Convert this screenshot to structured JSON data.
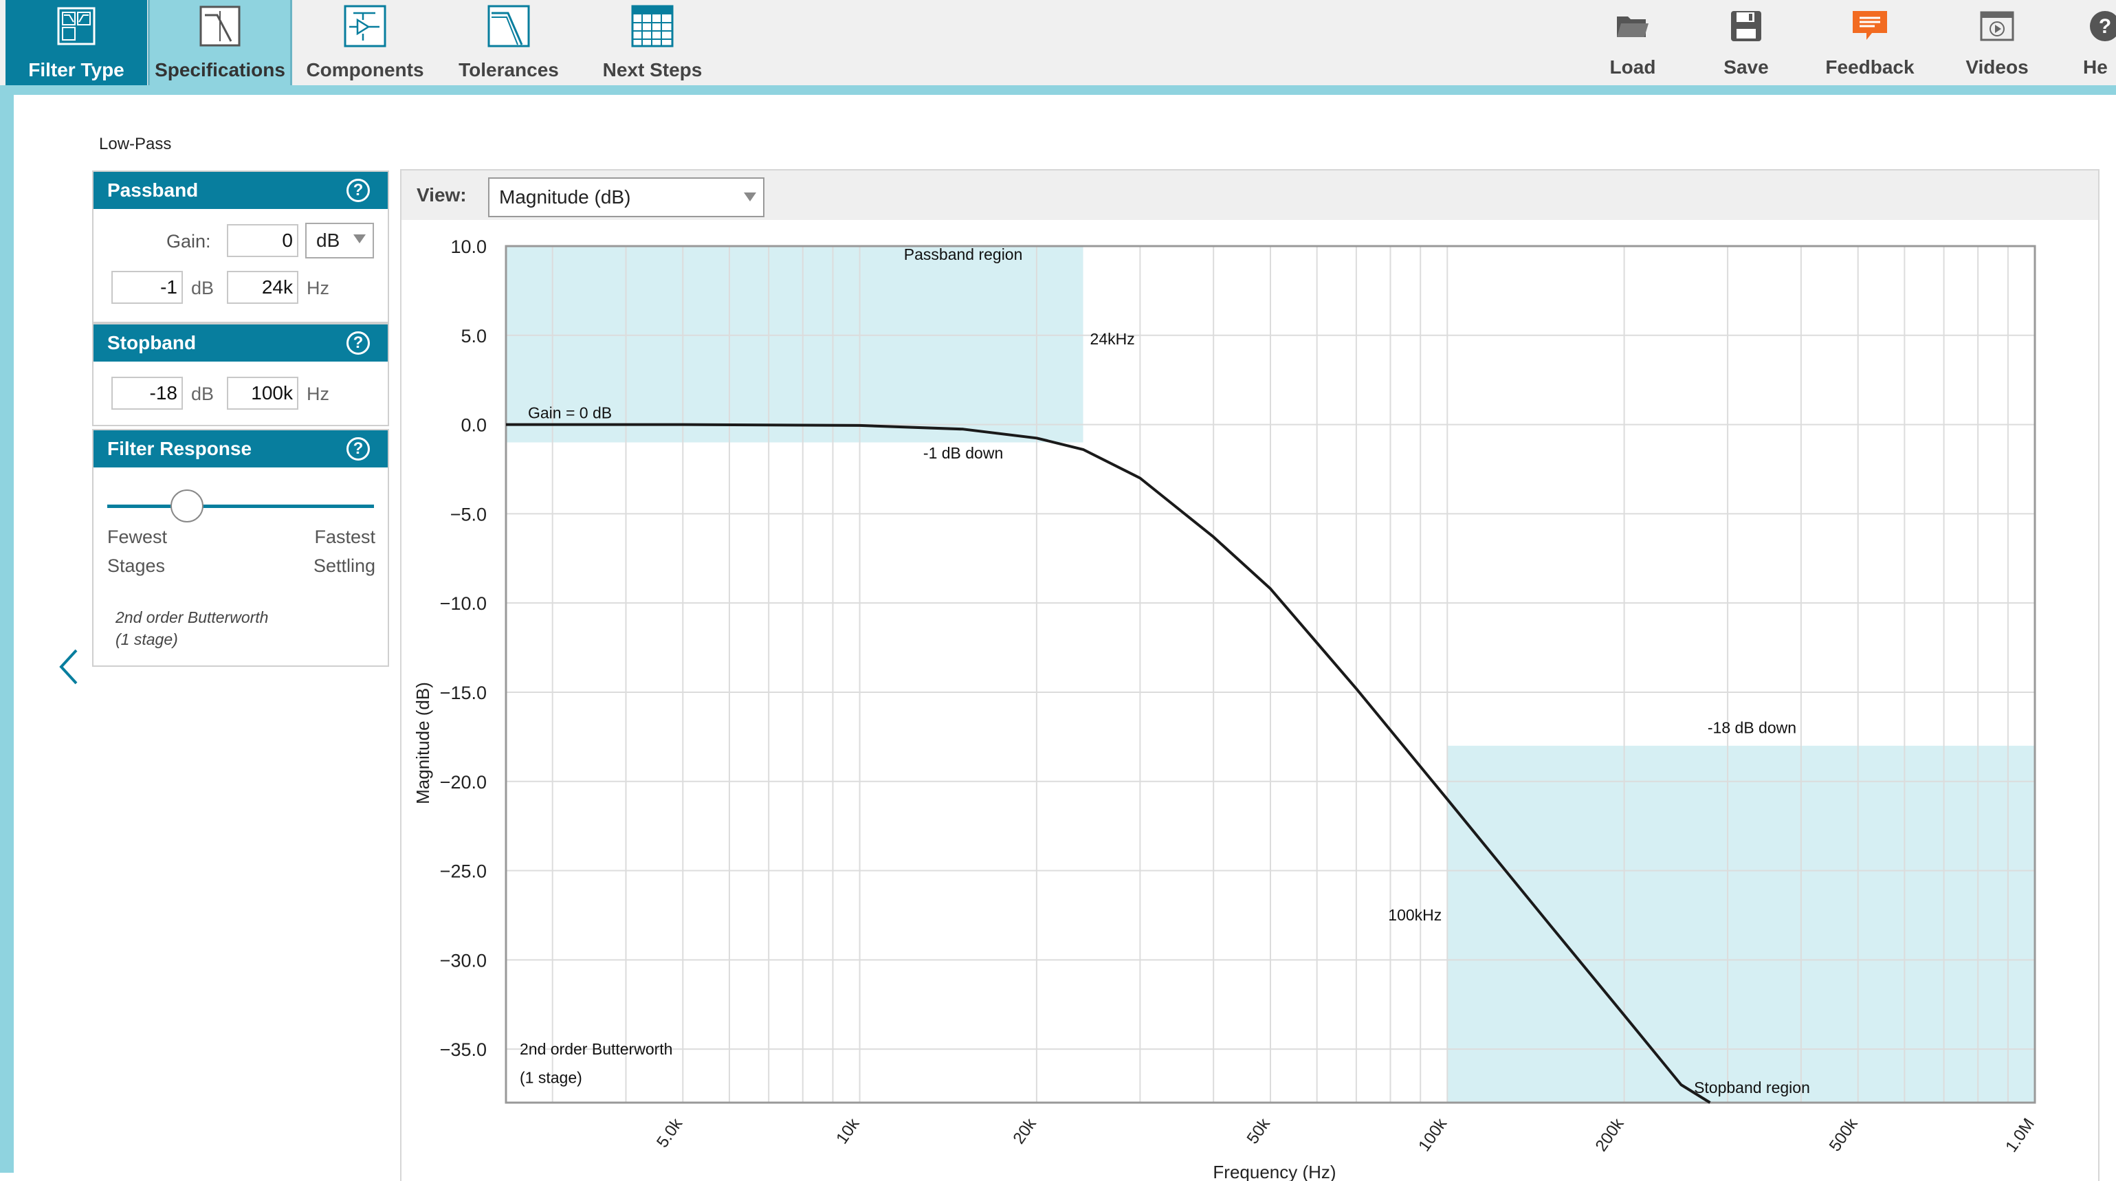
{
  "toolbar": {
    "left_tools": [
      {
        "label": "Filter Type",
        "icon": "filter-type-icon"
      },
      {
        "label": "Specifications",
        "icon": "specifications-icon"
      },
      {
        "label": "Components",
        "icon": "components-icon"
      },
      {
        "label": "Tolerances",
        "icon": "tolerances-icon"
      },
      {
        "label": "Next Steps",
        "icon": "next-steps-icon"
      }
    ],
    "right_tools": [
      {
        "label": "Load",
        "icon": "folder-icon"
      },
      {
        "label": "Save",
        "icon": "floppy-disk-icon"
      },
      {
        "label": "Feedback",
        "icon": "feedback-icon"
      },
      {
        "label": "Videos",
        "icon": "video-icon"
      },
      {
        "label": "He",
        "icon": "help-icon"
      }
    ],
    "active_tool": "Specifications"
  },
  "subtitle": "Low-Pass",
  "passband": {
    "title": "Passband",
    "help": "?",
    "gain_label": "Gain:",
    "gain_value": "0",
    "gain_unit": "dB",
    "ripple_value": "-1",
    "ripple_unit": "dB",
    "freq_value": "24k",
    "freq_unit": "Hz"
  },
  "stopband": {
    "title": "Stopband",
    "help": "?",
    "atten_value": "-18",
    "atten_unit": "dB",
    "freq_value": "100k",
    "freq_unit": "Hz"
  },
  "filter_response": {
    "title": "Filter Response",
    "help": "?",
    "left_line1": "Fewest",
    "left_line2": "Stages",
    "right_line1": "Fastest",
    "right_line2": "Settling",
    "slider_position": 0.3,
    "note_line1": "2nd order Butterworth",
    "note_line2": "(1 stage)"
  },
  "view": {
    "label": "View:",
    "selected": "Magnitude (dB)"
  },
  "colors": {
    "brand": "#087e9e",
    "accent_light": "#8fd3df",
    "region_fill": "#d6eff3",
    "feedback_orange": "#f26b21"
  },
  "chart_data": {
    "type": "line",
    "ylabel": "Magnitude (dB)",
    "xlabel": "Frequency (Hz)",
    "x_scale": "log",
    "xlim": [
      2500,
      1000000
    ],
    "ylim": [
      -38,
      10
    ],
    "y_ticks": [
      10,
      5,
      0,
      -5,
      -10,
      -15,
      -20,
      -25,
      -30,
      -35
    ],
    "y_tick_labels": [
      "10.0",
      "5.0",
      "0.0",
      "−5.0",
      "−10.0",
      "−15.0",
      "−20.0",
      "−25.0",
      "−30.0",
      "−35.0"
    ],
    "x_ticks": [
      5000,
      10000,
      20000,
      50000,
      100000,
      200000,
      500000,
      1000000
    ],
    "x_tick_labels": [
      "5.0k",
      "10k",
      "20k",
      "50k",
      "100k",
      "200k",
      "500k",
      "1.0M"
    ],
    "grid": true,
    "regions": [
      {
        "name": "Passband region",
        "x_from": 2500,
        "x_to": 24000,
        "y_from": -1,
        "y_to": 10
      },
      {
        "name": "Stopband region",
        "x_from": 100000,
        "x_to": 1000000,
        "y_from": -38,
        "y_to": -18
      }
    ],
    "annotations": {
      "passband_region": "Passband region",
      "passband_freq": "24kHz",
      "gain": "Gain = 0 dB",
      "passband_down": "-1 dB down",
      "stopband_down": "-18 dB down",
      "stopband_freq": "100kHz",
      "stopband_region": "Stopband region",
      "order_line1": "2nd order Butterworth",
      "order_line2": "(1 stage)"
    },
    "series": [
      {
        "response": "2nd order Butterworth low-pass",
        "cutoff_hz": 30000,
        "x": [
          2500,
          5000,
          10000,
          15000,
          20000,
          24000,
          30000,
          40000,
          50000,
          70000,
          100000,
          150000,
          200000,
          250000,
          280000
        ],
        "y": [
          0.0,
          0.0,
          -0.05,
          -0.26,
          -0.76,
          -1.4,
          -3.0,
          -6.3,
          -9.2,
          -14.8,
          -21.0,
          -28.1,
          -33.1,
          -37.0,
          -38.0
        ]
      }
    ]
  }
}
